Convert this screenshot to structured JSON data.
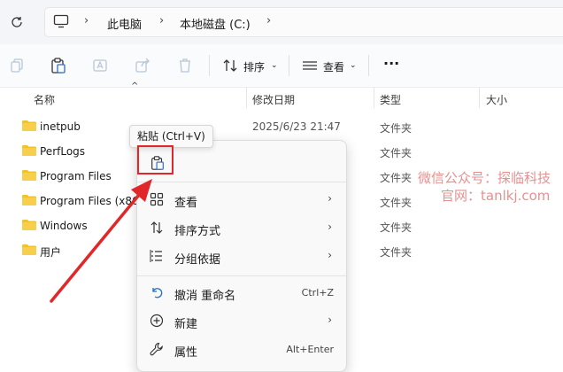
{
  "address": {
    "breadcrumbs": [
      "此电脑",
      "本地磁盘 (C:)"
    ]
  },
  "toolbar": {
    "sort_label": "排序",
    "view_label": "查看",
    "more_label": "···"
  },
  "columns": {
    "name": "名称",
    "date": "修改日期",
    "type": "类型",
    "size": "大小"
  },
  "files": [
    {
      "name": "inetpub",
      "date": "2025/6/23 21:47",
      "type": "文件夹"
    },
    {
      "name": "PerfLogs",
      "date": "",
      "type": "文件夹"
    },
    {
      "name": "Program Files",
      "date": "",
      "type": "文件夹"
    },
    {
      "name": "Program Files (x86)",
      "date": "",
      "type": "文件夹"
    },
    {
      "name": "Windows",
      "date": "",
      "type": "文件夹"
    },
    {
      "name": "用户",
      "date": "",
      "type": "文件夹"
    }
  ],
  "tooltip": "粘贴 (Ctrl+V)",
  "context_menu": {
    "items": [
      {
        "label": "查看",
        "icon": "grid-icon",
        "submenu": true
      },
      {
        "label": "排序方式",
        "icon": "sort-icon",
        "submenu": true
      },
      {
        "label": "分组依据",
        "icon": "group-icon",
        "submenu": true
      },
      {
        "label": "撤消 重命名",
        "icon": "undo-icon",
        "shortcut": "Ctrl+Z"
      },
      {
        "label": "新建",
        "icon": "new-icon",
        "submenu": true
      },
      {
        "label": "属性",
        "icon": "wrench-icon",
        "shortcut": "Alt+Enter"
      }
    ]
  },
  "watermark": {
    "line1": "微信公众号：探临科技",
    "line2": "官网：tanlkj.com"
  },
  "colors": {
    "folder": "#f3c12c",
    "highlight": "#e0282a"
  }
}
